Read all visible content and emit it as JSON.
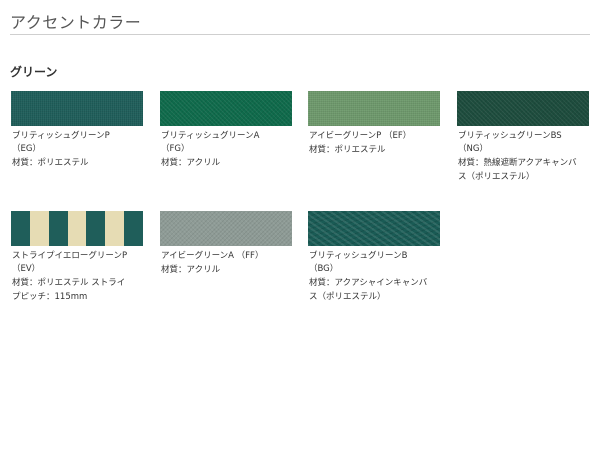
{
  "header": {
    "title": "アクセントカラー"
  },
  "section": {
    "heading": "グリーン"
  },
  "swatches": [
    {
      "name_line1": "ブリティッシュグリーンP",
      "name_line2": "（EG）",
      "material_line1": "材質：ポリエステル",
      "material_line2": "",
      "color": "#1f5e5a"
    },
    {
      "name_line1": "ブリティッシュグリーンA",
      "name_line2": "（FG）",
      "material_line1": "材質：アクリル",
      "material_line2": "",
      "color": "#0f6a4b"
    },
    {
      "name_line1": "アイビーグリーンP （EF）",
      "name_line2": "",
      "material_line1": "材質：ポリエステル",
      "material_line2": "",
      "color": "#6f9a6d"
    },
    {
      "name_line1": "ブリティッシュグリーンBS",
      "name_line2": "（NG）",
      "material_line1": "材質：熱線遮断アクアキャンバ",
      "material_line2": "ス（ポリエステル）",
      "color": "#1d4c3d"
    },
    {
      "name_line1": "ストライプイエローグリーンP",
      "name_line2": "（EV）",
      "material_line1": "材質：ポリエステル ストライ",
      "material_line2": "プピッチ：115mm",
      "color": "#1f5e5a",
      "stripe_color": "#e6dcb4"
    },
    {
      "name_line1": "アイビーグリーンA （FF）",
      "name_line2": "",
      "material_line1": "材質：アクリル",
      "material_line2": "",
      "color": "#8e9b96"
    },
    {
      "name_line1": "ブリティッシュグリーンB",
      "name_line2": "（BG）",
      "material_line1": "材質：アクアシャインキャンバ",
      "material_line2": "ス（ポリエステル）",
      "color": "#1a5b55"
    }
  ]
}
